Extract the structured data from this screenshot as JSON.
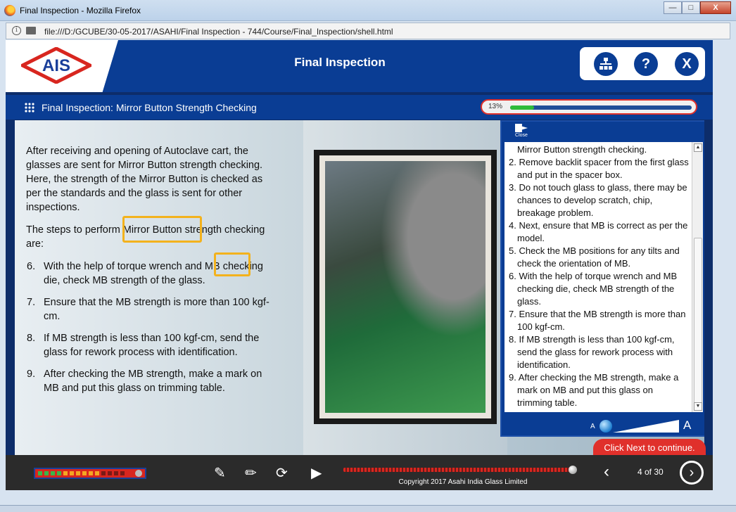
{
  "window": {
    "title": "Final Inspection - Mozilla Firefox",
    "min": "—",
    "max": "□",
    "close": "X"
  },
  "browser": {
    "url": "file:///D:/GCUBE/30-05-2017/ASAHI/Final Inspection - 744/Course/Final_Inspection/shell.html",
    "info_icon": "i"
  },
  "header": {
    "logo_text": "AIS",
    "title": "Final Inspection",
    "sitemap_icon": "sitemap-icon",
    "help_label": "?",
    "close_label": "X"
  },
  "subheader": {
    "title": "Final Inspection: Mirror Button Strength Checking",
    "progress_label": "13%",
    "progress_value": 0.13
  },
  "content": {
    "intro": "After receiving and opening of Autoclave cart, the glasses are sent for Mirror Button strength checking. Here, the strength of the Mirror Button is checked as per the standards and the glass is sent for other inspections.",
    "steps_intro": "The steps to perform Mirror Button strength checking are:",
    "steps": [
      {
        "num": "6.",
        "text": "With the help of torque wrench and MB checking die, check MB strength of the glass."
      },
      {
        "num": "7.",
        "text": "Ensure that the MB strength is more than 100 kgf-cm."
      },
      {
        "num": "8.",
        "text": "If MB strength is less than 100 kgf-cm, send the glass for rework process with identification."
      },
      {
        "num": "9.",
        "text": "After checking the MB strength, make a mark on MB and put this glass on trimming table."
      }
    ]
  },
  "notes": {
    "close_label": "Close",
    "items": [
      "Mirror Button strength checking.",
      "2. Remove backlit spacer from the first glass and put in the spacer box.",
      "3. Do not touch glass to glass, there may be chances to develop scratch, chip, breakage problem.",
      "4. Next, ensure that MB is correct as per the model.",
      "5. Check the MB positions for any tilts and check the orientation of MB.",
      "6. With the help of torque wrench and MB checking die, check MB strength of the glass.",
      "7. Ensure that the MB strength is more than 100 kgf-cm.",
      "8. If MB strength is less than 100 kgf-cm, send the glass for rework process with identification.",
      "9. After checking the MB strength, make a mark on MB and put this glass on trimming table."
    ],
    "small_a": "A",
    "large_a": "A"
  },
  "next_hint": "Click Next to continue.",
  "footer": {
    "copyright": "Copyright 2017 Asahi India Glass Limited",
    "page": "4 of 30",
    "prev_glyph": "‹",
    "next_glyph": "›",
    "play_glyph": "▶",
    "replay_glyph": "⟳",
    "notes_glyph": "✎",
    "audio_level": 0.7
  }
}
